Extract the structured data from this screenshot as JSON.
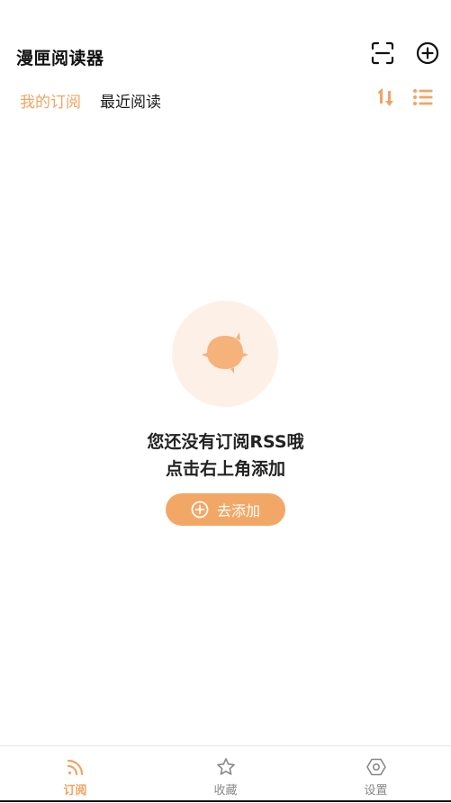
{
  "app": {
    "title": "漫匣阅读器"
  },
  "header": {
    "scan_icon": "scan-icon",
    "add_icon": "add-circle-icon"
  },
  "tabs": [
    {
      "label": "我的订阅",
      "active": true
    },
    {
      "label": "最近阅读",
      "active": false
    }
  ],
  "toolbar": {
    "sort_icon": "sort-icon",
    "view_icon": "list-view-icon"
  },
  "empty_state": {
    "line1": "您还没有订阅RSS哦",
    "line2": "点击右上角添加",
    "button_label": "去添加"
  },
  "bottom_nav": [
    {
      "label": "订阅",
      "icon": "rss-icon",
      "active": true
    },
    {
      "label": "收藏",
      "icon": "star-icon",
      "active": false
    },
    {
      "label": "设置",
      "icon": "settings-icon",
      "active": false
    }
  ],
  "colors": {
    "accent": "#f0a463",
    "button": "#f3a766",
    "illustration_bg": "#fdf1e7",
    "illustration_fg": "#f5b27a"
  }
}
